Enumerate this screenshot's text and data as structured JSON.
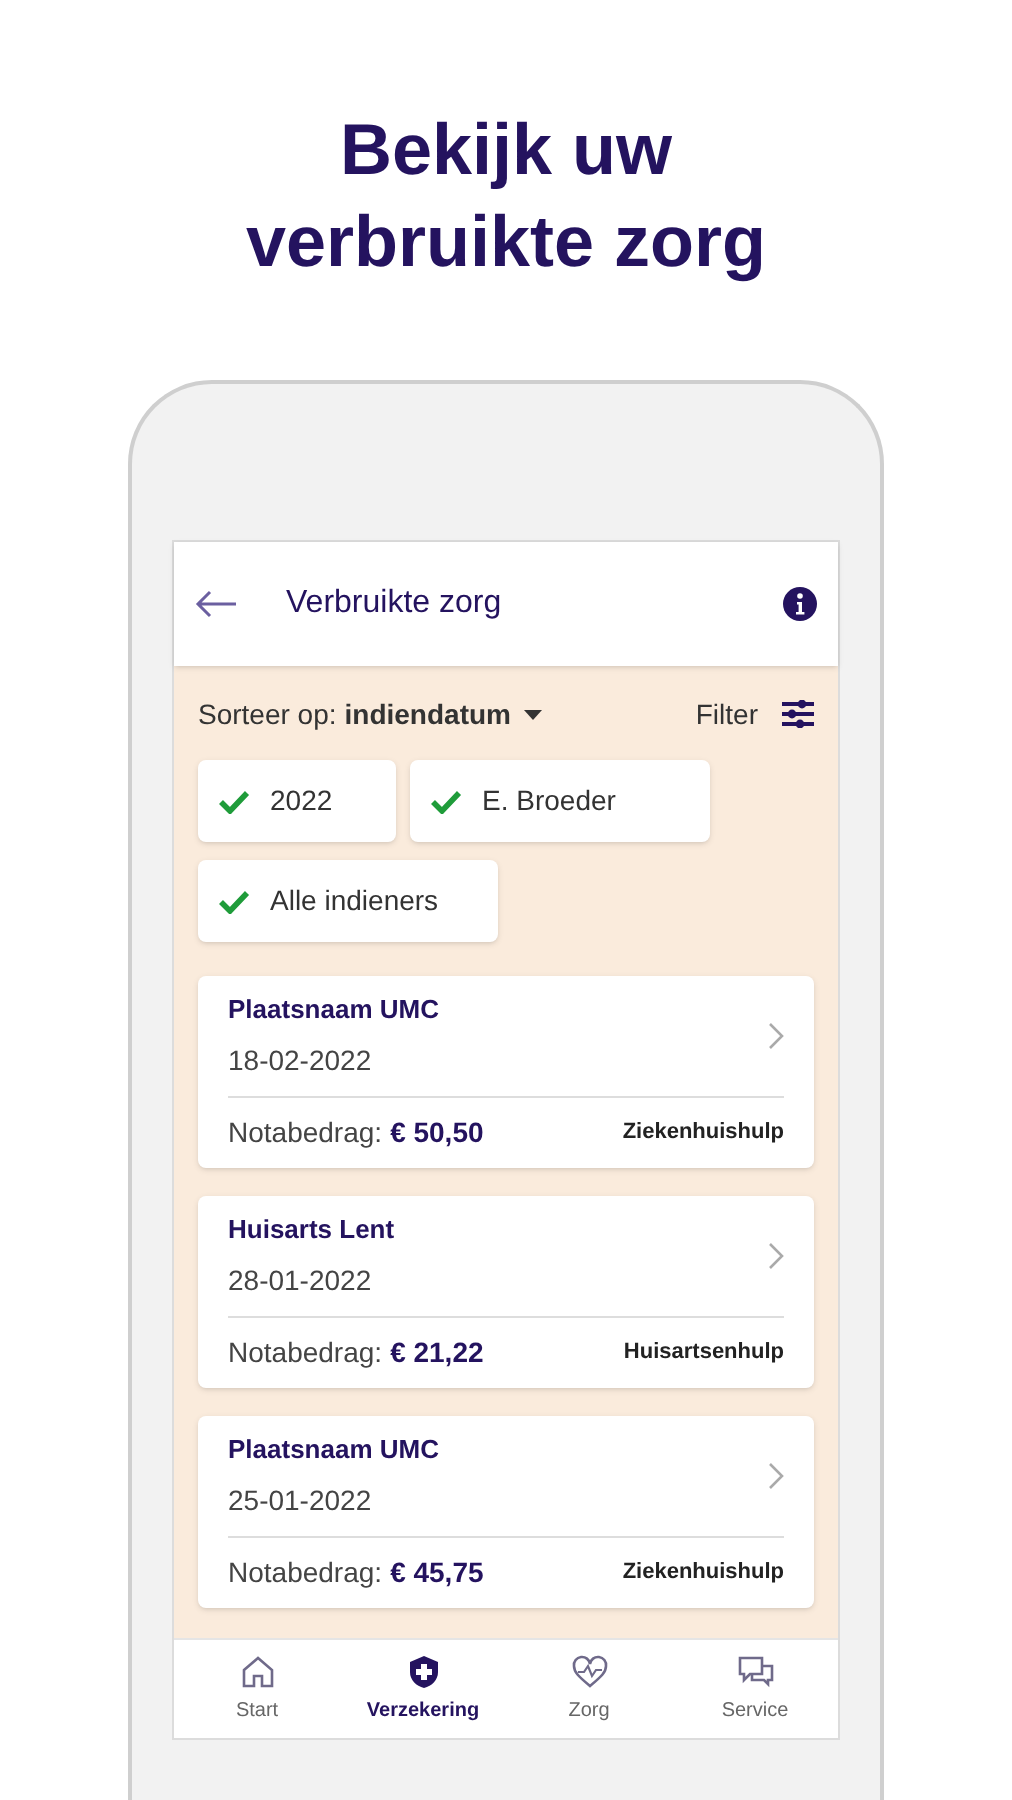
{
  "headline": [
    "Bekijk uw",
    "verbruikte zorg"
  ],
  "header": {
    "title": "Verbruikte zorg"
  },
  "sort": {
    "label": "Sorteer op:",
    "value": "indiendatum",
    "filter": "Filter"
  },
  "chips": [
    {
      "label": "2022",
      "checked": true
    },
    {
      "label": "E. Broeder",
      "checked": true
    },
    {
      "label": "Alle indieners",
      "checked": true
    }
  ],
  "claims": [
    {
      "provider": "Plaatsnaam UMC",
      "date": "18-02-2022",
      "amount_label": "Notabedrag:",
      "amount": "€ 50,50",
      "category": "Ziekenhuishulp"
    },
    {
      "provider": "Huisarts Lent",
      "date": "28-01-2022",
      "amount_label": "Notabedrag:",
      "amount": "€ 21,22",
      "category": "Huisartsenhulp"
    },
    {
      "provider": "Plaatsnaam UMC",
      "date": "25-01-2022",
      "amount_label": "Notabedrag:",
      "amount": "€ 45,75",
      "category": "Ziekenhuishulp"
    }
  ],
  "nav": [
    {
      "kind": "home",
      "label": "Start",
      "selected": false
    },
    {
      "kind": "shield",
      "label": "Verzekering",
      "selected": true
    },
    {
      "kind": "heart",
      "label": "Zorg",
      "selected": false
    },
    {
      "kind": "chat",
      "label": "Service",
      "selected": false
    }
  ]
}
